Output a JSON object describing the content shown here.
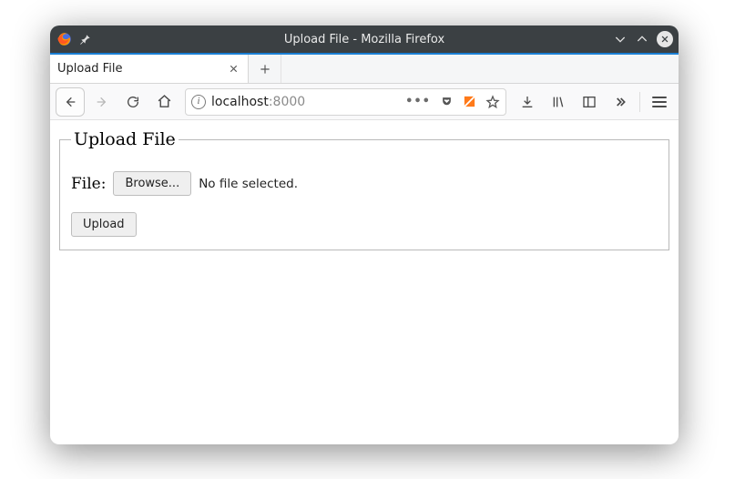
{
  "window": {
    "title": "Upload File - Mozilla Firefox"
  },
  "tabs": {
    "active_label": "Upload File"
  },
  "address": {
    "host": "localhost",
    "port": ":8000"
  },
  "page": {
    "legend": "Upload File",
    "file_label": "File:",
    "browse_label": "Browse...",
    "file_status": "No file selected.",
    "upload_label": "Upload"
  }
}
